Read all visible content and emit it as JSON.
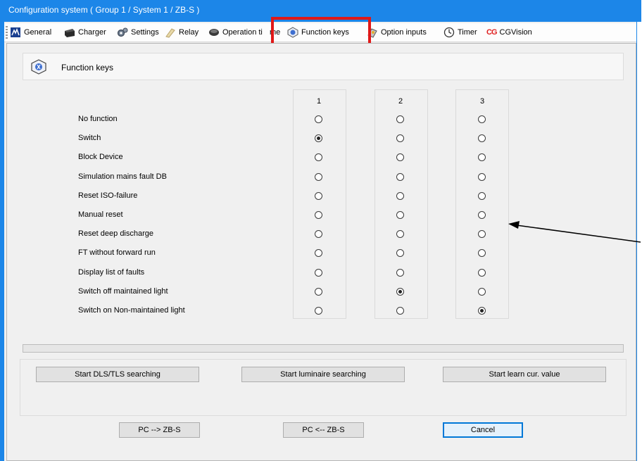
{
  "window": {
    "title": "Configuration system ( Group 1 / System 1 / ZB-S )"
  },
  "toolbar": {
    "items": [
      {
        "label": "General",
        "icon": "general-icon"
      },
      {
        "label": "Charger",
        "icon": "charger-icon"
      },
      {
        "label": "Settings",
        "icon": "settings-gear-icon"
      },
      {
        "label": "Relay",
        "icon": "relay-icon"
      },
      {
        "label": "Operation ti",
        "icon": "operation-time-icon"
      },
      {
        "label": "me",
        "icon": ""
      },
      {
        "label": "Function keys",
        "icon": "function-keys-icon"
      },
      {
        "label": "Option inputs",
        "icon": "option-inputs-icon"
      },
      {
        "label": "Timer",
        "icon": "clock-icon"
      },
      {
        "label": "CGVision",
        "icon": "cg-logo-icon"
      }
    ],
    "cg_logo_text": "CG"
  },
  "section": {
    "title": "Function keys"
  },
  "keys": {
    "columns": [
      "1",
      "2",
      "3"
    ],
    "rows": [
      "No function",
      "Switch",
      "Block Device",
      "Simulation mains fault DB",
      "Reset ISO-failure",
      "Manual reset",
      "Reset deep discharge",
      "FT without forward run",
      "Display list of faults",
      "Switch off maintained light",
      "Switch on Non-maintained light"
    ],
    "selected": {
      "1": "Switch",
      "2": "Switch off maintained light",
      "3": "Switch on Non-maintained light"
    }
  },
  "search_buttons": {
    "dls": "Start DLS/TLS searching",
    "luminaire": "Start luminaire searching",
    "learn": "Start learn cur. value"
  },
  "footer": {
    "pc_to": "PC --> ZB-S",
    "pc_from": "PC <-- ZB-S",
    "cancel": "Cancel"
  },
  "colors": {
    "titlebar": "#1c86e8",
    "highlight": "#e01818"
  }
}
